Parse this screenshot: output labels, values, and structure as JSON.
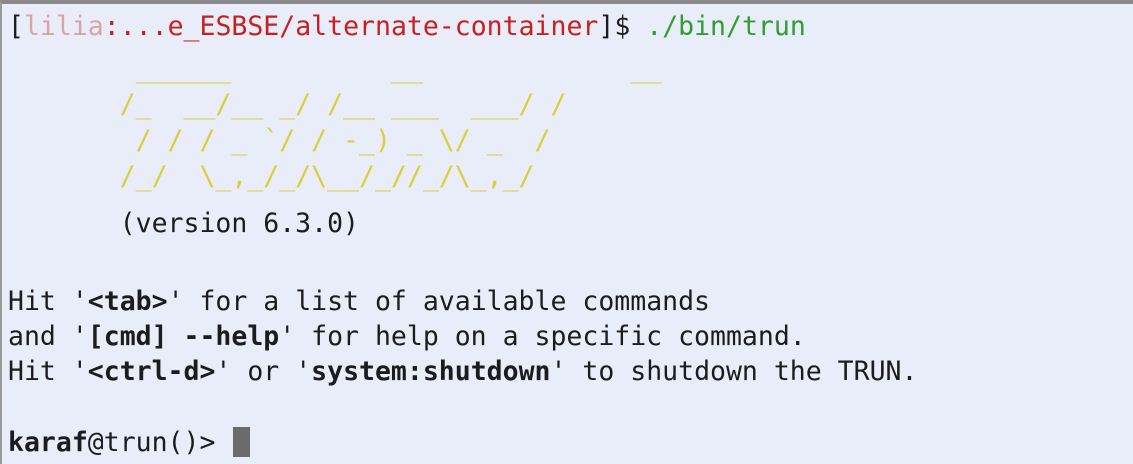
{
  "prompt": {
    "open_bracket": "[",
    "user": "lilia",
    "separator": ":",
    "path": "...e_ESBSE/alternate-container",
    "close": "]$ ",
    "command": "./bin/trun"
  },
  "banner": {
    "ascii_art": "        ______          __             __\n       /_  __/__ _/ /__ ___  ___/ /\n        / / / _ `/ / -_) _ \\/ _  /\n       /_/  \\_,_/_/\\__/_//_/\\_,_/",
    "version": "       (version 6.3.0)"
  },
  "help": {
    "line1": {
      "pre": "Hit '",
      "key": "<tab>",
      "post": "' for a list of available commands"
    },
    "line2": {
      "pre": "and '",
      "key": "[cmd] --help",
      "post": "' for help on a specific command."
    },
    "line3": {
      "pre": "Hit '",
      "key": "<ctrl-d>",
      "mid": "' or '",
      "key2": "system:shutdown",
      "post": "' to shutdown the TRUN."
    }
  },
  "karaf_prompt": {
    "user": "karaf",
    "host": "@trun()> "
  },
  "colors": {
    "background": "#e9edf9",
    "user": "#d9a4a4",
    "path": "#c8201e",
    "command": "#2f9e2f",
    "ascii": "#d9cf3b",
    "cursor": "#6b6b6b"
  }
}
